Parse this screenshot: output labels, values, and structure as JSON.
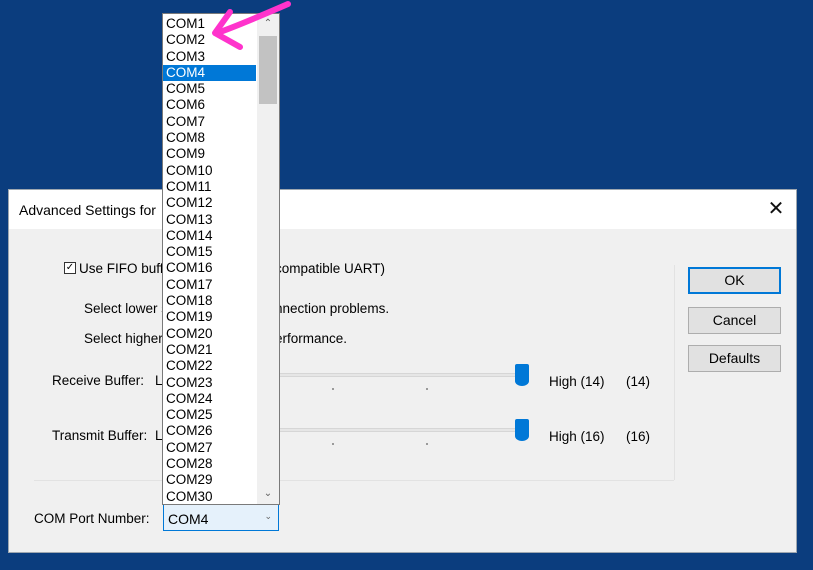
{
  "dialog": {
    "title": "Advanced Settings for",
    "close_icon": "close-icon",
    "fifo_checkbox_label": "Use FIFO buff",
    "fifo_checkbox_label_tail": "compatible UART)",
    "fifo_checked": true,
    "hint_lower": "Select lower s",
    "hint_lower_tail": "nnection problems.",
    "hint_higher": "Select higher",
    "hint_higher_tail": "erformance.",
    "receive": {
      "label": "Receive Buffer:",
      "low_label": "L",
      "high_text": "High (14)",
      "value_text": "(14)",
      "level": 14,
      "max": 14
    },
    "transmit": {
      "label": "Transmit Buffer:",
      "low_label": "L",
      "high_text": "High (16)",
      "value_text": "(16)",
      "level": 16,
      "max": 16
    },
    "com_port": {
      "label": "COM Port Number:",
      "value": "COM4"
    },
    "buttons": {
      "ok": "OK",
      "cancel": "Cancel",
      "defaults": "Defaults"
    }
  },
  "dropdown": {
    "selected": "COM4",
    "items": [
      "COM1",
      "COM2",
      "COM3",
      "COM4",
      "COM5",
      "COM6",
      "COM7",
      "COM8",
      "COM9",
      "COM10",
      "COM11",
      "COM12",
      "COM13",
      "COM14",
      "COM15",
      "COM16",
      "COM17",
      "COM18",
      "COM19",
      "COM20",
      "COM21",
      "COM22",
      "COM23",
      "COM24",
      "COM25",
      "COM26",
      "COM27",
      "COM28",
      "COM29",
      "COM30"
    ]
  },
  "colors": {
    "desktop": "#0b3d7e",
    "accent": "#0078d7",
    "annotation_arrow": "#ff33cc"
  }
}
